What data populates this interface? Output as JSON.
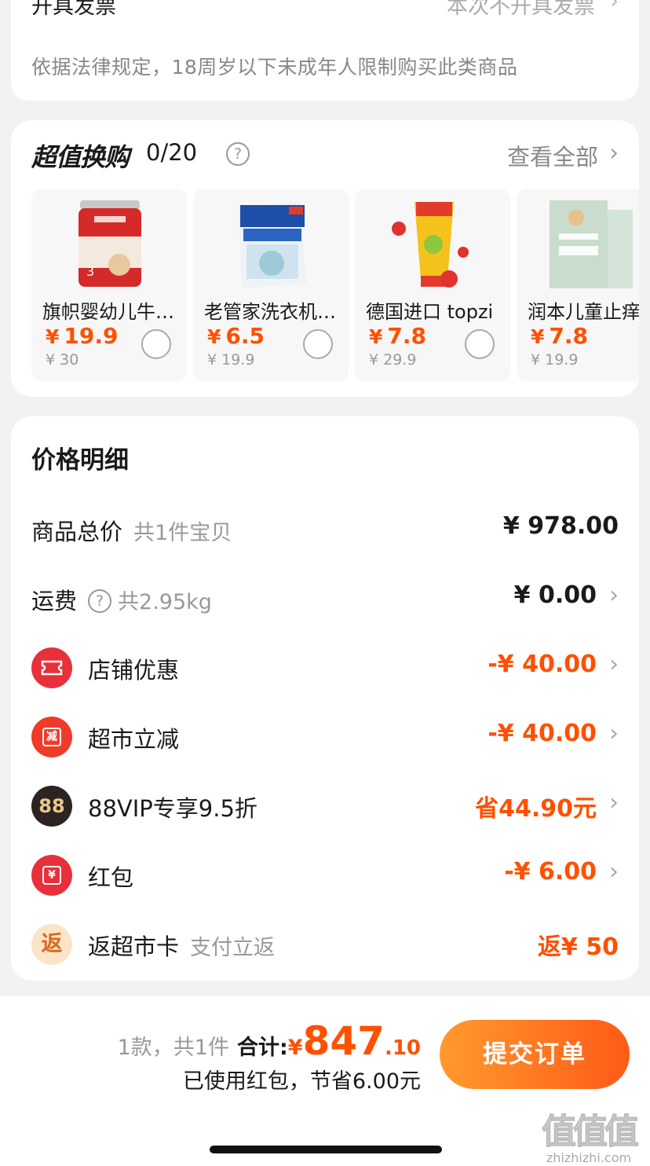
{
  "top_card": {
    "invoice_label": "开具发票",
    "invoice_value": "本次不开具发票",
    "legal_note": "依据法律规定，18周岁以下未成年人限制购买此类商品"
  },
  "exchange": {
    "title": "超值换购",
    "count": "0/20",
    "help_icon": "?",
    "view_all": "查看全部",
    "products": [
      {
        "name": "旗帜婴幼儿牛奶粉",
        "currency": "¥",
        "price": "19.9",
        "orig": "¥ 30"
      },
      {
        "name": "老管家洗衣机槽清洁",
        "currency": "¥",
        "price": "6.5",
        "orig": "¥ 19.9"
      },
      {
        "name": "德国进口 topzi",
        "currency": "¥",
        "price": "7.8",
        "orig": "¥ 29.9"
      },
      {
        "name": "润本儿童止痒",
        "currency": "¥",
        "price": "7.8",
        "orig": "¥ 19.9"
      }
    ]
  },
  "price_detail": {
    "title": "价格明细",
    "goods_total_label": "商品总价",
    "goods_total_sub": "共1件宝贝",
    "goods_total_amount": "¥ 978.00",
    "shipping_label": "运费",
    "shipping_help": "?",
    "shipping_sub": "共2.95kg",
    "shipping_amount": "¥ 0.00",
    "store_discount_label": "店铺优惠",
    "store_discount_amount": "-¥ 40.00",
    "market_discount_icon": "减",
    "market_discount_label": "超市立减",
    "market_discount_amount": "-¥ 40.00",
    "vip_icon": "88",
    "vip_label": "88VIP专享9.5折",
    "vip_amount": "省44.90元",
    "redpacket_icon": "¥",
    "redpacket_label": "红包",
    "redpacket_amount": "-¥ 6.00",
    "cashback_icon": "返",
    "cashback_label": "返超市卡",
    "cashback_sub": "支付立返",
    "cashback_amount": "返¥ 50"
  },
  "bottom": {
    "count_text": "1款，共1件",
    "total_label": "合计:",
    "currency": "¥",
    "total_int": "847",
    "total_dec": ".10",
    "saved_note": "已使用红包，节省6.00元",
    "submit_label": "提交订单"
  },
  "watermark": {
    "logo": "值值值",
    "url": "zhizhizhi.com"
  },
  "colors": {
    "accent": "#ff5000",
    "submit_start": "#ff9a2e",
    "submit_end": "#ff5a17"
  }
}
